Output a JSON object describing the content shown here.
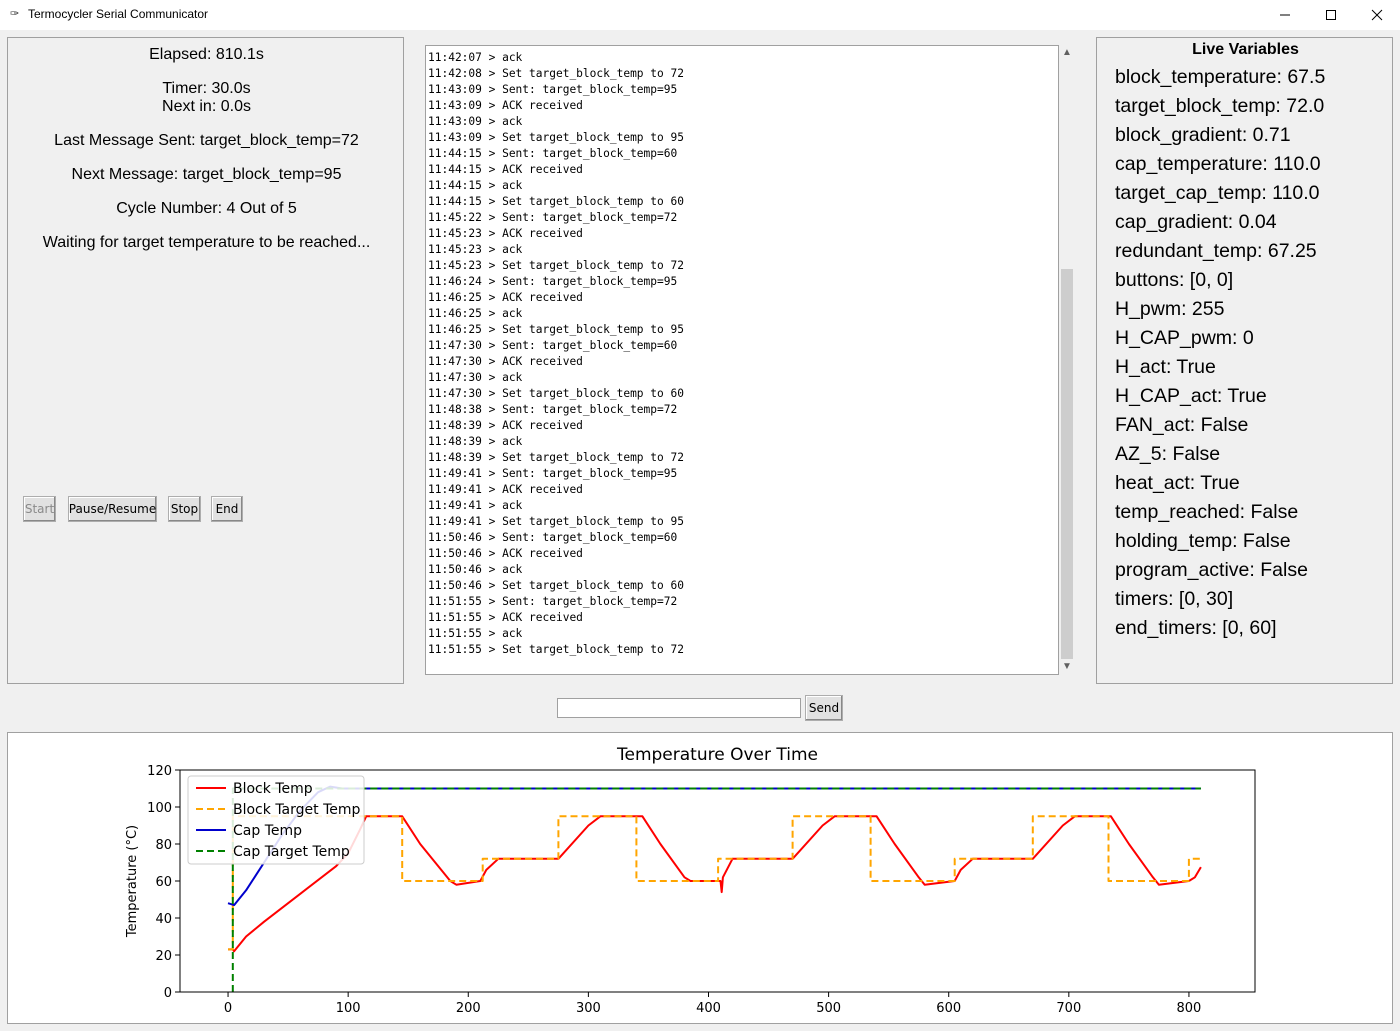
{
  "window": {
    "title": "Termocycler Serial Communicator",
    "icon": "feather-icon"
  },
  "status": {
    "elapsed": "Elapsed: 810.1s",
    "timer": "Timer: 30.0s",
    "next_in": "Next in: 0.0s",
    "last_message": "Last Message Sent: target_block_temp=72",
    "next_message": "Next Message: target_block_temp=95",
    "cycle": "Cycle Number: 4 Out of 5",
    "waiting": "Waiting for target temperature to be reached..."
  },
  "controls": {
    "start": "Start",
    "pause": "Pause/Resume",
    "stop": "Stop",
    "end": "End"
  },
  "log": [
    "11:42:07 > ack",
    "11:42:08 > Set target_block_temp to 72",
    "11:43:09 > Sent: target_block_temp=95",
    "11:43:09 > ACK received",
    "11:43:09 > ack",
    "11:43:09 > Set target_block_temp to 95",
    "11:44:15 > Sent: target_block_temp=60",
    "11:44:15 > ACK received",
    "11:44:15 > ack",
    "11:44:15 > Set target_block_temp to 60",
    "11:45:22 > Sent: target_block_temp=72",
    "11:45:23 > ACK received",
    "11:45:23 > ack",
    "11:45:23 > Set target_block_temp to 72",
    "11:46:24 > Sent: target_block_temp=95",
    "11:46:25 > ACK received",
    "11:46:25 > ack",
    "11:46:25 > Set target_block_temp to 95",
    "11:47:30 > Sent: target_block_temp=60",
    "11:47:30 > ACK received",
    "11:47:30 > ack",
    "11:47:30 > Set target_block_temp to 60",
    "11:48:38 > Sent: target_block_temp=72",
    "11:48:39 > ACK received",
    "11:48:39 > ack",
    "11:48:39 > Set target_block_temp to 72",
    "11:49:41 > Sent: target_block_temp=95",
    "11:49:41 > ACK received",
    "11:49:41 > ack",
    "11:49:41 > Set target_block_temp to 95",
    "11:50:46 > Sent: target_block_temp=60",
    "11:50:46 > ACK received",
    "11:50:46 > ack",
    "11:50:46 > Set target_block_temp to 60",
    "11:51:55 > Sent: target_block_temp=72",
    "11:51:55 > ACK received",
    "11:51:55 > ack",
    "11:51:55 > Set target_block_temp to 72"
  ],
  "live_variables": {
    "title": "Live Variables",
    "items": [
      "block_temperature: 67.5",
      "target_block_temp: 72.0",
      "block_gradient: 0.71",
      "cap_temperature: 110.0",
      "target_cap_temp: 110.0",
      "cap_gradient: 0.04",
      "redundant_temp: 67.25",
      "buttons: [0, 0]",
      "H_pwm: 255",
      "H_CAP_pwm: 0",
      "H_act: True",
      "H_CAP_act: True",
      "FAN_act: False",
      "AZ_5: False",
      "heat_act: True",
      "temp_reached: False",
      "holding_temp: False",
      "program_active: False",
      "timers: [0, 30]",
      "end_timers: [0, 60]"
    ]
  },
  "send": {
    "label": "Send",
    "value": ""
  },
  "chart_data": {
    "type": "line",
    "title": "Temperature Over Time",
    "ylabel": "Temperature (°C)",
    "xlim": [
      -40,
      855
    ],
    "ylim": [
      0,
      120
    ],
    "xticks": [
      0,
      100,
      200,
      300,
      400,
      500,
      600,
      700,
      800
    ],
    "yticks": [
      0,
      20,
      40,
      60,
      80,
      100,
      120
    ],
    "legend_position": "top-left",
    "grid": false,
    "series": [
      {
        "name": "Block Temp",
        "color": "#ff0000",
        "style": "solid",
        "points": [
          [
            0,
            23
          ],
          [
            4,
            23
          ],
          [
            5,
            22
          ],
          [
            15,
            30
          ],
          [
            30,
            38
          ],
          [
            60,
            53
          ],
          [
            90,
            68
          ],
          [
            100,
            75
          ],
          [
            110,
            88
          ],
          [
            115,
            95
          ],
          [
            145,
            95
          ],
          [
            160,
            80
          ],
          [
            185,
            60
          ],
          [
            190,
            58
          ],
          [
            210,
            60
          ],
          [
            215,
            66
          ],
          [
            225,
            72
          ],
          [
            275,
            72
          ],
          [
            300,
            90
          ],
          [
            310,
            95
          ],
          [
            345,
            95
          ],
          [
            360,
            80
          ],
          [
            380,
            62
          ],
          [
            385,
            60
          ],
          [
            410,
            60
          ],
          [
            411,
            54
          ],
          [
            412,
            62
          ],
          [
            420,
            72
          ],
          [
            470,
            72
          ],
          [
            495,
            90
          ],
          [
            505,
            95
          ],
          [
            540,
            95
          ],
          [
            555,
            80
          ],
          [
            575,
            62
          ],
          [
            580,
            58
          ],
          [
            605,
            60
          ],
          [
            610,
            66
          ],
          [
            620,
            72
          ],
          [
            670,
            72
          ],
          [
            695,
            90
          ],
          [
            705,
            95
          ],
          [
            735,
            95
          ],
          [
            750,
            80
          ],
          [
            770,
            62
          ],
          [
            775,
            58
          ],
          [
            800,
            60
          ],
          [
            805,
            62
          ],
          [
            810,
            67.5
          ]
        ]
      },
      {
        "name": "Block Target Temp",
        "color": "#ffa500",
        "style": "dashed",
        "points": [
          [
            0,
            23
          ],
          [
            4,
            23
          ],
          [
            4,
            95
          ],
          [
            145,
            95
          ],
          [
            145,
            60
          ],
          [
            212,
            60
          ],
          [
            212,
            72
          ],
          [
            275,
            72
          ],
          [
            275,
            95
          ],
          [
            340,
            95
          ],
          [
            340,
            60
          ],
          [
            408,
            60
          ],
          [
            408,
            72
          ],
          [
            470,
            72
          ],
          [
            470,
            95
          ],
          [
            535,
            95
          ],
          [
            535,
            60
          ],
          [
            605,
            60
          ],
          [
            605,
            72
          ],
          [
            670,
            72
          ],
          [
            670,
            95
          ],
          [
            733,
            95
          ],
          [
            733,
            60
          ],
          [
            800,
            60
          ],
          [
            800,
            72
          ],
          [
            810,
            72
          ]
        ]
      },
      {
        "name": "Cap Temp",
        "color": "#0000cc",
        "style": "solid",
        "points": [
          [
            0,
            48
          ],
          [
            5,
            47
          ],
          [
            15,
            55
          ],
          [
            30,
            70
          ],
          [
            45,
            85
          ],
          [
            60,
            98
          ],
          [
            75,
            108
          ],
          [
            85,
            111
          ],
          [
            95,
            110
          ],
          [
            110,
            110
          ],
          [
            810,
            110
          ]
        ]
      },
      {
        "name": "Cap Target Temp",
        "color": "#008000",
        "style": "dashed",
        "points": [
          [
            4,
            0
          ],
          [
            4,
            110
          ],
          [
            810,
            110
          ]
        ]
      }
    ]
  }
}
